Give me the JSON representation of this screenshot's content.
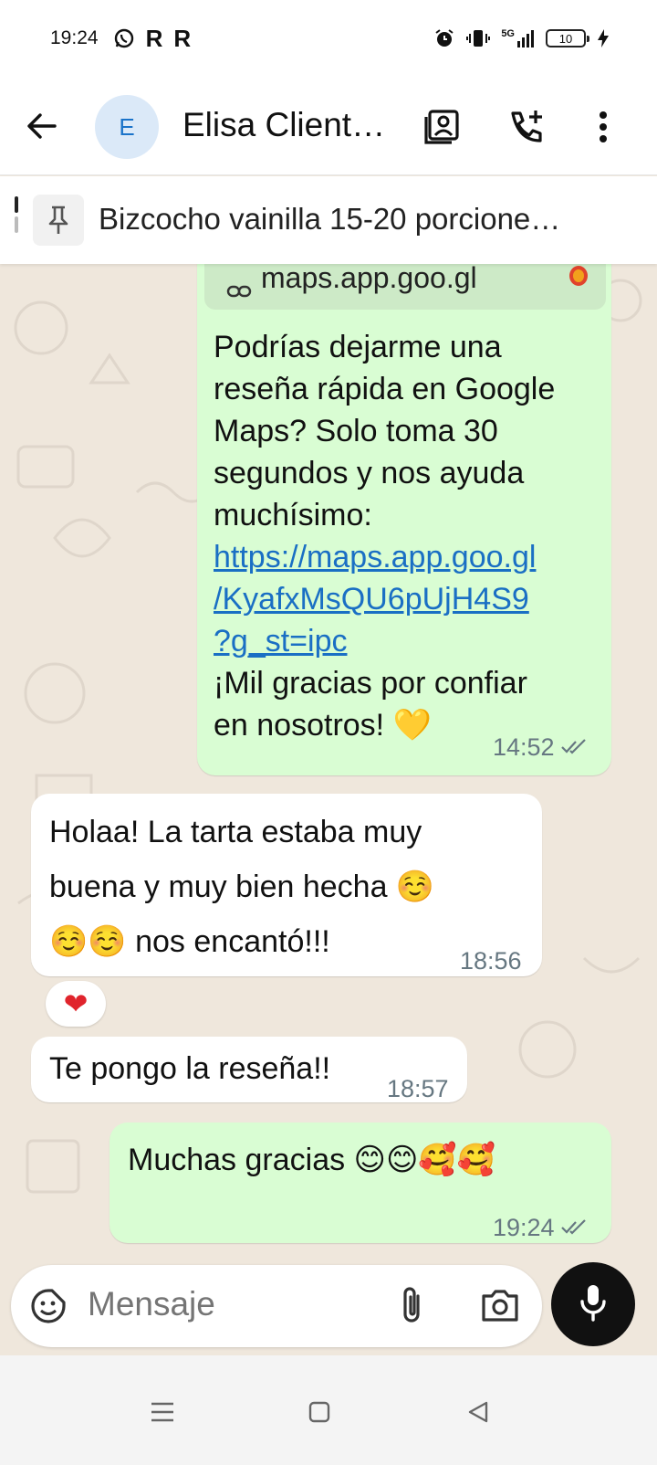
{
  "status_bar": {
    "time": "19:24",
    "left_icons": [
      "whatsapp-icon",
      "r-app-icon",
      "r-app-icon"
    ],
    "right_icons": [
      "alarm-icon",
      "vibrate-icon",
      "signal-5g-icon",
      "battery-icon",
      "charging-icon"
    ],
    "network": "5G",
    "battery": "10"
  },
  "header": {
    "avatar_letter": "E",
    "contact_name": "Elisa Client…",
    "icons": [
      "back-arrow-icon",
      "contact-card-icon",
      "add-call-icon",
      "more-vert-icon"
    ]
  },
  "pinned": {
    "text": "Bizcocho vainilla 15-20 porcione…",
    "icon": "pin-icon"
  },
  "messages": [
    {
      "direction": "out",
      "preview_link": "maps.app.goo.gl",
      "lines": [
        "Podrías dejarme una",
        "reseña rápida en Google",
        "Maps? Solo toma 30",
        "segundos y nos ayuda",
        "muchísimo:"
      ],
      "link_lines": [
        "https://maps.app.goo.gl",
        "/KyafxMsQU6pUjH4S9",
        "?g_st=ipc"
      ],
      "after_lines": [
        "¡Mil gracias por confiar",
        "en nosotros! 💛"
      ],
      "time": "14:52",
      "status": "read"
    },
    {
      "direction": "in",
      "lines": [
        "Holaa! La tarta estaba muy",
        "buena y muy bien hecha ☺️",
        "☺️☺️ nos encantó!!!"
      ],
      "time": "18:56",
      "reaction": "❤"
    },
    {
      "direction": "in",
      "lines": [
        "Te pongo la reseña!!"
      ],
      "time": "18:57"
    },
    {
      "direction": "out",
      "lines": [
        "Muchas gracias 😊😊🥰🥰"
      ],
      "time": "19:24",
      "status": "read"
    }
  ],
  "composer": {
    "placeholder": "Mensaje",
    "icons": [
      "sticker-icon",
      "attach-icon",
      "camera-icon",
      "mic-icon"
    ]
  },
  "nav_bar": {
    "icons": [
      "menu-icon",
      "home-icon",
      "back-icon"
    ]
  },
  "colors": {
    "outgoing_bubble": "#d9fdd3",
    "incoming_bubble": "#ffffff",
    "chat_background": "#efe7dc",
    "link": "#1a6fc4",
    "mic_button": "#111111"
  }
}
